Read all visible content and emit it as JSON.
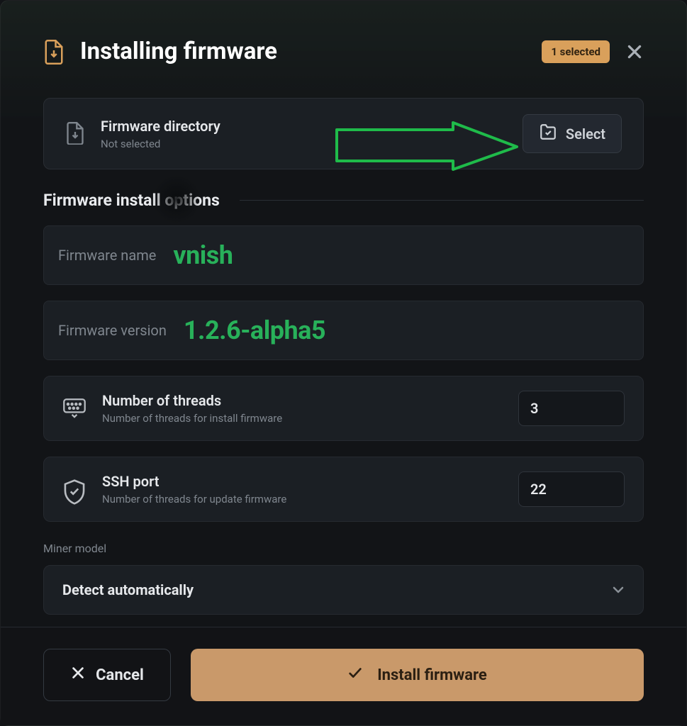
{
  "header": {
    "title": "Installing firmware",
    "selected_badge": "1 selected"
  },
  "directory": {
    "label": "Firmware directory",
    "status": "Not selected",
    "select_button": "Select"
  },
  "options": {
    "heading": "Firmware install options",
    "firmware_name_label": "Firmware name",
    "firmware_name_value": "vnish",
    "firmware_version_label": "Firmware version",
    "firmware_version_value": "1.2.6-alpha5"
  },
  "threads": {
    "label": "Number of threads",
    "sub": "Number of threads for install firmware",
    "value": "3"
  },
  "ssh": {
    "label": "SSH port",
    "sub": "Number of threads for update firmware",
    "value": "22"
  },
  "miner": {
    "label": "Miner model",
    "value": "Detect automatically"
  },
  "footer": {
    "cancel": "Cancel",
    "install": "Install firmware"
  },
  "colors": {
    "accent": "#d9a05b",
    "marker_green": "#28b15a",
    "panel": "#1b1f24"
  }
}
